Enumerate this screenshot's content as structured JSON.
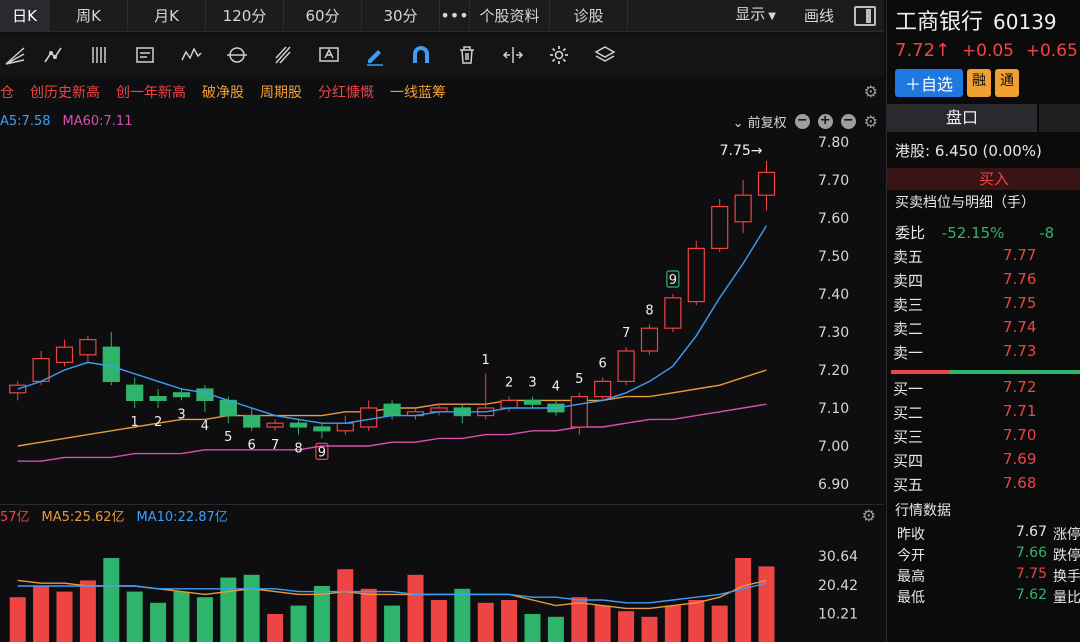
{
  "tabs": {
    "items": [
      "日K",
      "周K",
      "月K",
      "120分",
      "60分",
      "30分"
    ],
    "more": "•••",
    "extra": [
      "个股资料",
      "诊股"
    ],
    "display": "显示",
    "draw": "画线"
  },
  "tags": [
    {
      "label": "仓",
      "color": "#ee4444"
    },
    {
      "label": "创历史新高",
      "color": "#ee4444"
    },
    {
      "label": "创一年新高",
      "color": "#ee4444"
    },
    {
      "label": "破净股",
      "color": "#f0a030"
    },
    {
      "label": "周期股",
      "color": "#f0a030"
    },
    {
      "label": "分红慷慨",
      "color": "#ee4444"
    },
    {
      "label": "一线蓝筹",
      "color": "#f0a030"
    }
  ],
  "ma_legend": {
    "ma5": "A5:7.58",
    "ma60": "MA60:7.11",
    "adjust": "前复权"
  },
  "vol_legend": {
    "vol": "57亿",
    "ma5": "MA5:25.62亿",
    "ma10": "MA10:22.87亿"
  },
  "colors": {
    "up": "#ee4444",
    "down": "#2fb56b",
    "ma5": "#3d9ef5",
    "ma_mid": "#e89a3a",
    "ma_long": "#d94fb0"
  },
  "chart_data": {
    "type": "candlestick",
    "ylim": [
      6.9,
      7.8
    ],
    "yticks": [
      "7.80",
      "7.70",
      "7.60",
      "7.50",
      "7.40",
      "7.30",
      "7.20",
      "7.10",
      "7.00",
      "6.90"
    ],
    "vol_ticks": [
      "30.64",
      "20.42",
      "10.21"
    ],
    "vol_ylim": [
      0,
      40
    ],
    "max_label": "7.75→",
    "candles": [
      {
        "o": 7.14,
        "c": 7.16,
        "h": 7.17,
        "l": 7.12
      },
      {
        "o": 7.17,
        "c": 7.23,
        "h": 7.25,
        "l": 7.16
      },
      {
        "o": 7.22,
        "c": 7.26,
        "h": 7.28,
        "l": 7.21
      },
      {
        "o": 7.24,
        "c": 7.28,
        "h": 7.29,
        "l": 7.22
      },
      {
        "o": 7.26,
        "c": 7.17,
        "h": 7.3,
        "l": 7.16
      },
      {
        "o": 7.16,
        "c": 7.12,
        "h": 7.18,
        "l": 7.1
      },
      {
        "o": 7.13,
        "c": 7.12,
        "h": 7.15,
        "l": 7.1
      },
      {
        "o": 7.14,
        "c": 7.13,
        "h": 7.15,
        "l": 7.12
      },
      {
        "o": 7.15,
        "c": 7.12,
        "h": 7.16,
        "l": 7.09
      },
      {
        "o": 7.12,
        "c": 7.08,
        "h": 7.13,
        "l": 7.06
      },
      {
        "o": 7.08,
        "c": 7.05,
        "h": 7.1,
        "l": 7.04
      },
      {
        "o": 7.05,
        "c": 7.06,
        "h": 7.07,
        "l": 7.04
      },
      {
        "o": 7.06,
        "c": 7.05,
        "h": 7.07,
        "l": 7.03
      },
      {
        "o": 7.05,
        "c": 7.04,
        "h": 7.06,
        "l": 7.02
      },
      {
        "o": 7.04,
        "c": 7.06,
        "h": 7.08,
        "l": 7.03
      },
      {
        "o": 7.05,
        "c": 7.1,
        "h": 7.12,
        "l": 7.04
      },
      {
        "o": 7.11,
        "c": 7.08,
        "h": 7.12,
        "l": 7.07
      },
      {
        "o": 7.08,
        "c": 7.09,
        "h": 7.1,
        "l": 7.07
      },
      {
        "o": 7.09,
        "c": 7.1,
        "h": 7.11,
        "l": 7.08
      },
      {
        "o": 7.1,
        "c": 7.08,
        "h": 7.11,
        "l": 7.06
      },
      {
        "o": 7.08,
        "c": 7.1,
        "h": 7.19,
        "l": 7.07
      },
      {
        "o": 7.1,
        "c": 7.12,
        "h": 7.13,
        "l": 7.09
      },
      {
        "o": 7.12,
        "c": 7.11,
        "h": 7.13,
        "l": 7.1
      },
      {
        "o": 7.11,
        "c": 7.09,
        "h": 7.12,
        "l": 7.08
      },
      {
        "o": 7.05,
        "c": 7.13,
        "h": 7.14,
        "l": 7.03
      },
      {
        "o": 7.13,
        "c": 7.17,
        "h": 7.18,
        "l": 7.12
      },
      {
        "o": 7.17,
        "c": 7.25,
        "h": 7.26,
        "l": 7.16
      },
      {
        "o": 7.25,
        "c": 7.31,
        "h": 7.32,
        "l": 7.24
      },
      {
        "o": 7.31,
        "c": 7.39,
        "h": 7.4,
        "l": 7.3
      },
      {
        "o": 7.38,
        "c": 7.52,
        "h": 7.54,
        "l": 7.37
      },
      {
        "o": 7.52,
        "c": 7.63,
        "h": 7.65,
        "l": 7.51
      },
      {
        "o": 7.59,
        "c": 7.66,
        "h": 7.7,
        "l": 7.56
      },
      {
        "o": 7.66,
        "c": 7.72,
        "h": 7.75,
        "l": 7.62
      }
    ],
    "labels": [
      {
        "i": 5,
        "t": "1"
      },
      {
        "i": 6,
        "t": "2"
      },
      {
        "i": 7,
        "t": "3"
      },
      {
        "i": 8,
        "t": "4"
      },
      {
        "i": 9,
        "t": "5"
      },
      {
        "i": 10,
        "t": "6"
      },
      {
        "i": 11,
        "t": "7"
      },
      {
        "i": 12,
        "t": "8"
      },
      {
        "i": 13,
        "t": "9",
        "box": "red",
        "pos": "below"
      },
      {
        "i": 20,
        "t": "1",
        "pos": "above"
      },
      {
        "i": 21,
        "t": "2",
        "pos": "above"
      },
      {
        "i": 22,
        "t": "3",
        "pos": "above"
      },
      {
        "i": 23,
        "t": "4",
        "pos": "above"
      },
      {
        "i": 24,
        "t": "5",
        "pos": "above"
      },
      {
        "i": 25,
        "t": "6",
        "pos": "above"
      },
      {
        "i": 26,
        "t": "7",
        "pos": "above"
      },
      {
        "i": 27,
        "t": "8",
        "pos": "above"
      },
      {
        "i": 28,
        "t": "9",
        "pos": "above",
        "box": "green"
      }
    ],
    "ma5": [
      7.15,
      7.17,
      7.2,
      7.22,
      7.21,
      7.19,
      7.17,
      7.15,
      7.14,
      7.12,
      7.1,
      7.08,
      7.07,
      7.06,
      7.06,
      7.07,
      7.08,
      7.08,
      7.09,
      7.09,
      7.09,
      7.1,
      7.1,
      7.1,
      7.11,
      7.12,
      7.14,
      7.17,
      7.21,
      7.29,
      7.39,
      7.48,
      7.58
    ],
    "ma_mid": [
      7.0,
      7.01,
      7.02,
      7.03,
      7.04,
      7.05,
      7.06,
      7.07,
      7.07,
      7.08,
      7.08,
      7.08,
      7.08,
      7.08,
      7.09,
      7.09,
      7.1,
      7.1,
      7.11,
      7.11,
      7.11,
      7.12,
      7.12,
      7.12,
      7.12,
      7.12,
      7.13,
      7.13,
      7.14,
      7.15,
      7.16,
      7.18,
      7.2
    ],
    "ma_long": [
      6.96,
      6.96,
      6.97,
      6.97,
      6.97,
      6.98,
      6.98,
      6.98,
      6.99,
      6.99,
      6.99,
      6.99,
      6.99,
      7.0,
      7.0,
      7.0,
      7.01,
      7.01,
      7.02,
      7.02,
      7.03,
      7.03,
      7.04,
      7.04,
      7.05,
      7.05,
      7.06,
      7.07,
      7.07,
      7.08,
      7.09,
      7.1,
      7.11
    ],
    "volumes": [
      16,
      20,
      18,
      22,
      30,
      18,
      14,
      18,
      16,
      23,
      24,
      10,
      13,
      20,
      26,
      19,
      13,
      24,
      15,
      19,
      14,
      15,
      10,
      9,
      16,
      13,
      11,
      9,
      13,
      15,
      13,
      30,
      27
    ],
    "vol_ma5": [
      22,
      21,
      21,
      20,
      20,
      20,
      19,
      18,
      17,
      18,
      19,
      18,
      17,
      17,
      18,
      17,
      17,
      17,
      17,
      17,
      17,
      17,
      15,
      13,
      14,
      13,
      12,
      12,
      13,
      14,
      16,
      20,
      22
    ],
    "vol_ma10": [
      20,
      20,
      20,
      20,
      20,
      20,
      19,
      19,
      19,
      19,
      19,
      19,
      18,
      18,
      18,
      18,
      18,
      17,
      17,
      17,
      17,
      17,
      16,
      16,
      15,
      15,
      14,
      14,
      15,
      16,
      17,
      19,
      21
    ]
  },
  "quote": {
    "name": "工商银行",
    "code": "60139",
    "price": "7.72↑",
    "change": "+0.05",
    "pct": "+0.65",
    "add_watch": "＋自选",
    "rong": "融",
    "tong": "通",
    "pankou": "盘口",
    "hk": "港股:  6.450 (0.00%)",
    "buy": "买入",
    "detail_title": "买卖档位与明细（手）",
    "weibi_label": "委比",
    "weibi_val": "-52.15%",
    "weibi_cut": "-8",
    "asks": [
      {
        "label": "卖五",
        "price": "7.77"
      },
      {
        "label": "卖四",
        "price": "7.76"
      },
      {
        "label": "卖三",
        "price": "7.75"
      },
      {
        "label": "卖二",
        "price": "7.74"
      },
      {
        "label": "卖一",
        "price": "7.73"
      }
    ],
    "bids": [
      {
        "label": "买一",
        "price": "7.72"
      },
      {
        "label": "买二",
        "price": "7.71"
      },
      {
        "label": "买三",
        "price": "7.70"
      },
      {
        "label": "买四",
        "price": "7.69"
      },
      {
        "label": "买五",
        "price": "7.68"
      }
    ],
    "market_title": "行情数据",
    "market": [
      {
        "label": "昨收",
        "value": "7.67",
        "color": "#e6e6e6",
        "label2": "涨停"
      },
      {
        "label": "今开",
        "value": "7.66",
        "color": "#2fb56b",
        "label2": "跌停"
      },
      {
        "label": "最高",
        "value": "7.75",
        "color": "#ee4444",
        "label2": "换手"
      },
      {
        "label": "最低",
        "value": "7.62",
        "color": "#2fb56b",
        "label2": "量比"
      }
    ]
  }
}
